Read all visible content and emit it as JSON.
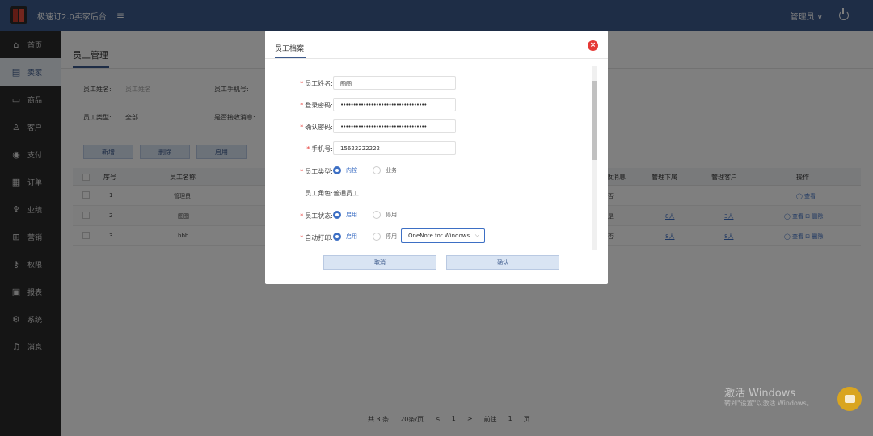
{
  "topbar": {
    "app_title": "极速订2.0卖家后台",
    "menu_toggle": "≡",
    "user": "管理员 ∨"
  },
  "sidebar": {
    "items": [
      {
        "label": "首页",
        "icon": "home-icon",
        "glyph": "⌂"
      },
      {
        "label": "卖家",
        "icon": "store-icon",
        "glyph": "▤"
      },
      {
        "label": "商品",
        "icon": "product-icon",
        "glyph": "▭"
      },
      {
        "label": "客户",
        "icon": "customer-icon",
        "glyph": "♙"
      },
      {
        "label": "支付",
        "icon": "payment-icon",
        "glyph": "◉"
      },
      {
        "label": "订单",
        "icon": "order-icon",
        "glyph": "▦"
      },
      {
        "label": "业绩",
        "icon": "trophy-icon",
        "glyph": "♆"
      },
      {
        "label": "营销",
        "icon": "gift-icon",
        "glyph": "⊞"
      },
      {
        "label": "权限",
        "icon": "key-icon",
        "glyph": "⚷"
      },
      {
        "label": "报表",
        "icon": "report-icon",
        "glyph": "▣"
      },
      {
        "label": "系统",
        "icon": "settings-icon",
        "glyph": "⚙"
      },
      {
        "label": "消息",
        "icon": "bell-icon",
        "glyph": "♫"
      }
    ],
    "active_index": 1
  },
  "page": {
    "title": "员工管理",
    "filters": {
      "name_label": "员工姓名:",
      "name_placeholder": "员工姓名",
      "phone_label": "员工手机号:",
      "type_label": "员工类型:",
      "type_value": "全部",
      "receive_label": "是否接收消息:"
    },
    "buttons": [
      "新增",
      "删除",
      "启用"
    ],
    "table": {
      "headers": [
        "序号",
        "员工名称",
        "收消息",
        "管理下属",
        "管理客户",
        "操作"
      ],
      "rows": [
        {
          "no": "1",
          "name": "管理员",
          "msg": "否",
          "sub": "",
          "cust": "",
          "ops": "◯ 查看"
        },
        {
          "no": "2",
          "name": "图图",
          "msg": "是",
          "sub": "8人",
          "cust": "3人",
          "ops": "◯ 查看  ⊡ 删除"
        },
        {
          "no": "3",
          "name": "bbb",
          "msg": "否",
          "sub": "8人",
          "cust": "8人",
          "ops": "◯ 查看  ⊡ 删除"
        }
      ]
    },
    "pager": {
      "total": "共 3 条",
      "size": "20条/页",
      "prev": "<",
      "current": "1",
      "next": ">",
      "goto": "前往",
      "goto_page": "1",
      "page_unit": "页"
    }
  },
  "modal": {
    "title": "员工档案",
    "close": "×",
    "fields": {
      "name_label": "员工姓名:",
      "name_value": "图图",
      "password_label": "登录密码:",
      "password_value": "••••••••••••••••••••••••••••••••••",
      "confirm_label": "确认密码:",
      "confirm_value": "••••••••••••••••••••••••••••••••••",
      "phone_label": "手机号:",
      "phone_value": "15622222222",
      "type_label": "员工类型:",
      "type_opt_internal": "内控",
      "type_opt_sales": "业务",
      "role_label": "员工角色:",
      "role_value": "普通员工",
      "status_label": "员工状态:",
      "status_opt_on": "启用",
      "status_opt_off": "停用",
      "print_label": "自动打印:",
      "print_opt_on": "启用",
      "print_opt_off": "停用",
      "printer_value": "OneNote for Windows"
    },
    "cancel": "取消",
    "confirm": "确认"
  },
  "watermark": {
    "line1": "激活 Windows",
    "line2": "转到\"设置\"以激活 Windows。"
  }
}
